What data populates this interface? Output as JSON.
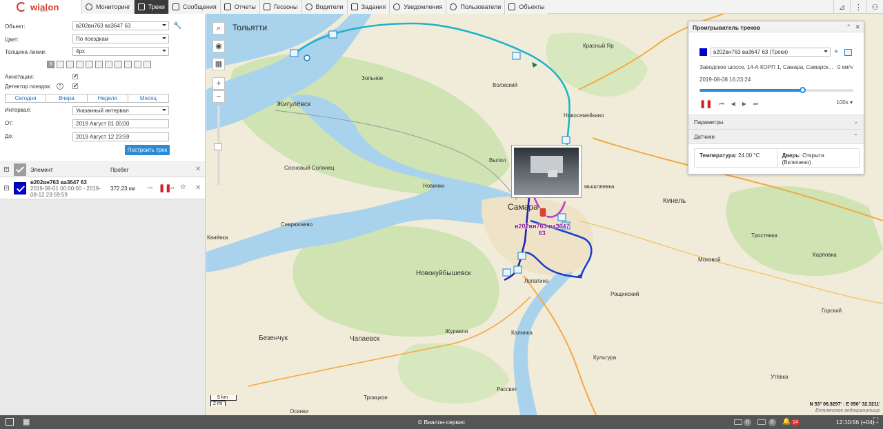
{
  "app": {
    "logo_text": "wialon",
    "logo_sub": "service"
  },
  "menu": [
    {
      "label": "Мониторинг",
      "active": false
    },
    {
      "label": "Треки",
      "active": true
    },
    {
      "label": "Сообщения",
      "active": false
    },
    {
      "label": "Отчеты",
      "active": false
    },
    {
      "label": "Геозоны",
      "active": false
    },
    {
      "label": "Водители",
      "active": false
    },
    {
      "label": "Задания",
      "active": false
    },
    {
      "label": "Уведомления",
      "active": false
    },
    {
      "label": "Пользователи",
      "active": false
    },
    {
      "label": "Объекты",
      "active": false
    }
  ],
  "form": {
    "object_label": "Объект:",
    "object_value": "в202вн763 ва3647 63",
    "color_label": "Цвет:",
    "color_value": "По поездкам",
    "width_label": "Толщина линии:",
    "width_value": "4px",
    "icon_count": "3",
    "annotations_label": "Аннотации:",
    "annotations_checked": "✔",
    "detector_label": "Детектор поездок:",
    "detector_checked": "✔",
    "help": "?",
    "tabs": [
      "Сегодня",
      "Вчера",
      "Неделя",
      "Месяц"
    ],
    "interval_label": "Интервал:",
    "interval_value": "Указанный интервал",
    "from_label": "От:",
    "from_value": "2019 Август 01 00:00",
    "to_label": "До:",
    "to_value": "2019 Август 12 23:59",
    "build_button": "Построить трек"
  },
  "table": {
    "col_element": "Элемент",
    "col_mileage": "Пробег",
    "rows": [
      {
        "name": "в202вн763 ва3647 63",
        "period": "2019-08-01 00:00:00 - 2019-08-12 23:59:59",
        "mileage": "372.23 км"
      }
    ]
  },
  "map": {
    "labels": {
      "togliatti": "Тольятти",
      "zhigulevsk": "Жигулёвск",
      "zolnoe": "Зольное",
      "krasny_yar": "Красный Яр",
      "volzhsky": "Волжский",
      "novosemeykino": "Новосемейкино",
      "vyplos": "Выпол",
      "sosnovy": "Сосновый Солонец",
      "novinki": "Новинки",
      "samara": "Самара",
      "myshlyaevka": "мышляевка",
      "kinel": "Кинель",
      "sevryukaevo": "Севрюкаево",
      "kanevka": "Канёвка",
      "trostyanka": "Тростянка",
      "novokuybyshevsk": "Новокуйбышевск",
      "mokhovoy": "Моховой",
      "karpovka": "Карповка",
      "lopatino": "Лопатино",
      "roshchinsky": "Рощинский",
      "gorsky": "Горский",
      "bezenchuk": "Безенчук",
      "chapaevsk": "Чапаевск",
      "zhuravli": "Журавли",
      "kalinka": "Калинка",
      "kultura": "Культура",
      "utevka": "Утёвка",
      "troitskoe": "Троицкое",
      "rassvet": "Рассвет",
      "osinki": "Осинки"
    },
    "car_label_line1": "в202вн763 ва3647",
    "car_label_line2": "63",
    "scale_km": "5 km",
    "scale_mi": "2 mi",
    "coordinates": "N 53° 06.9297' : E 050° 32.3211'",
    "coordinates_sub": "Ветлянское водохранилище"
  },
  "player": {
    "title": "Проигрыватель треков",
    "unit_select": "в202вн763 ва3647 63 (Треки)",
    "unit_color": "#0000c8",
    "address": "Заводское шоссе, 14-А КОРП 1, Самара, Самарск...",
    "speed": "0 км/ч",
    "time": "2019-08-08 16:23:24",
    "progress": 0.67,
    "playback_speed": "100x",
    "section_params": "Параметры",
    "section_sensors": "Датчики",
    "sensor_temp_label": "Температура:",
    "sensor_temp_value": "24.00 °C",
    "sensor_door_label": "Дверь:",
    "sensor_door_value": "Открыта (Включено)"
  },
  "footer": {
    "copyright": "© Виалон-сервис",
    "count_a": "0",
    "count_b": "0",
    "count_c": "14",
    "clock": "12:10:56 (+04)"
  }
}
